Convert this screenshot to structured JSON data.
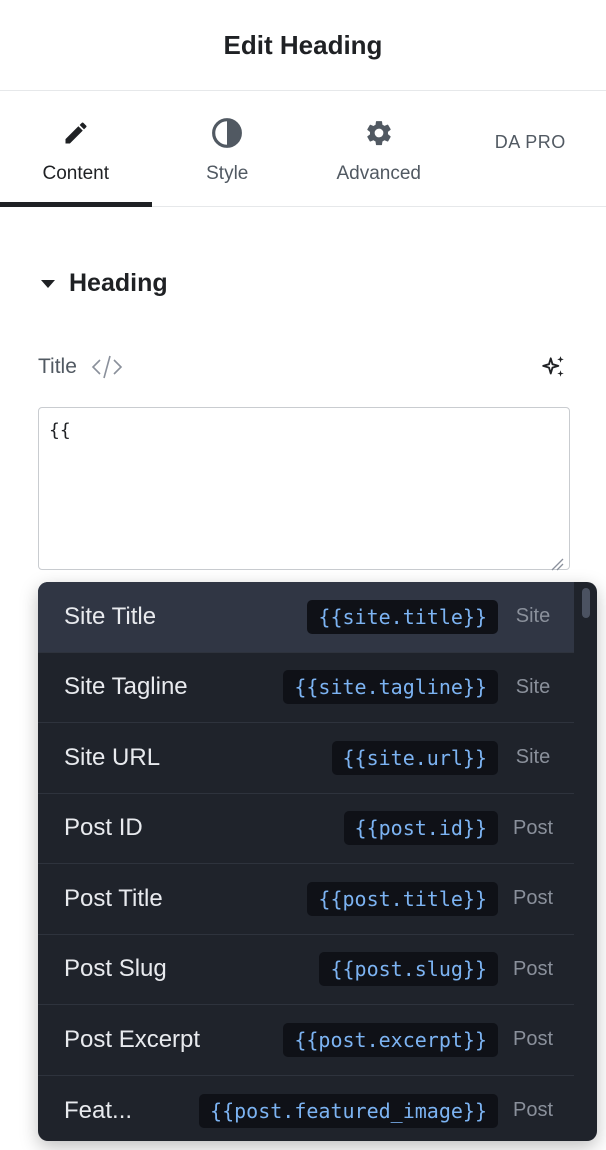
{
  "header": {
    "title": "Edit Heading"
  },
  "tabs": [
    {
      "label": "Content",
      "icon": "pencil-icon"
    },
    {
      "label": "Style",
      "icon": "half-circle-icon"
    },
    {
      "label": "Advanced",
      "icon": "gear-icon"
    },
    {
      "label": "DA PRO"
    }
  ],
  "section": {
    "title": "Heading"
  },
  "field": {
    "label": "Title",
    "value": "{{"
  },
  "dropdown": {
    "items": [
      {
        "label": "Site Title",
        "token": "{{site.title}}",
        "category": "Site"
      },
      {
        "label": "Site Tagline",
        "token": "{{site.tagline}}",
        "category": "Site"
      },
      {
        "label": "Site URL",
        "token": "{{site.url}}",
        "category": "Site"
      },
      {
        "label": "Post ID",
        "token": "{{post.id}}",
        "category": "Post"
      },
      {
        "label": "Post Title",
        "token": "{{post.title}}",
        "category": "Post"
      },
      {
        "label": "Post Slug",
        "token": "{{post.slug}}",
        "category": "Post"
      },
      {
        "label": "Post Excerpt",
        "token": "{{post.excerpt}}",
        "category": "Post"
      },
      {
        "label": "Feat...",
        "token": "{{post.featured_image}}",
        "category": "Post"
      }
    ]
  },
  "colors": {
    "dropdown_bg": "#1f232b",
    "token_text": "#7cb3f2",
    "active_tab_underline": "#1f2124"
  }
}
